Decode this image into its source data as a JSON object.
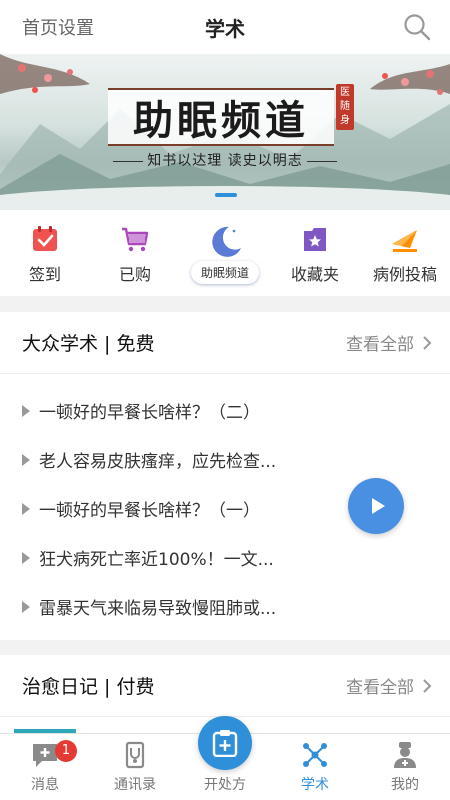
{
  "header": {
    "left_link": "首页设置",
    "title": "学术"
  },
  "banner": {
    "slogan": "助眠频道",
    "seal": "医随身",
    "tagline": "知书以达理 读史以明志"
  },
  "quick_actions": [
    {
      "label": "签到",
      "icon": "calendar-check-icon",
      "color": "#ef5350"
    },
    {
      "label": "已购",
      "icon": "shopping-cart-icon",
      "color": "#ab47bc"
    },
    {
      "label": "助眠频道",
      "icon": "moon-icon",
      "color": "#5c7bd6"
    },
    {
      "label": "收藏夹",
      "icon": "folder-star-icon",
      "color": "#7e57c2"
    },
    {
      "label": "病例投稿",
      "icon": "paper-plane-icon",
      "color": "#ff8f00"
    }
  ],
  "section_free": {
    "title": "大众学术 | 免费",
    "more": "查看全部",
    "articles": [
      "一顿好的早餐长啥样？（二）",
      "老人容易皮肤瘙痒，应先检查...",
      "一顿好的早餐长啥样？（一）",
      "狂犬病死亡率近100%！一文...",
      "雷暴天气来临易导致慢阻肺或..."
    ]
  },
  "section_paid": {
    "title": "治愈日记 | 付费",
    "more": "查看全部"
  },
  "tabbar": {
    "tabs": [
      {
        "label": "消息",
        "badge": "1"
      },
      {
        "label": "通讯录"
      },
      {
        "label": "开处方"
      },
      {
        "label": "学术"
      },
      {
        "label": "我的"
      }
    ]
  },
  "colors": {
    "accent": "#2f8fd8",
    "badge": "#e53935"
  }
}
